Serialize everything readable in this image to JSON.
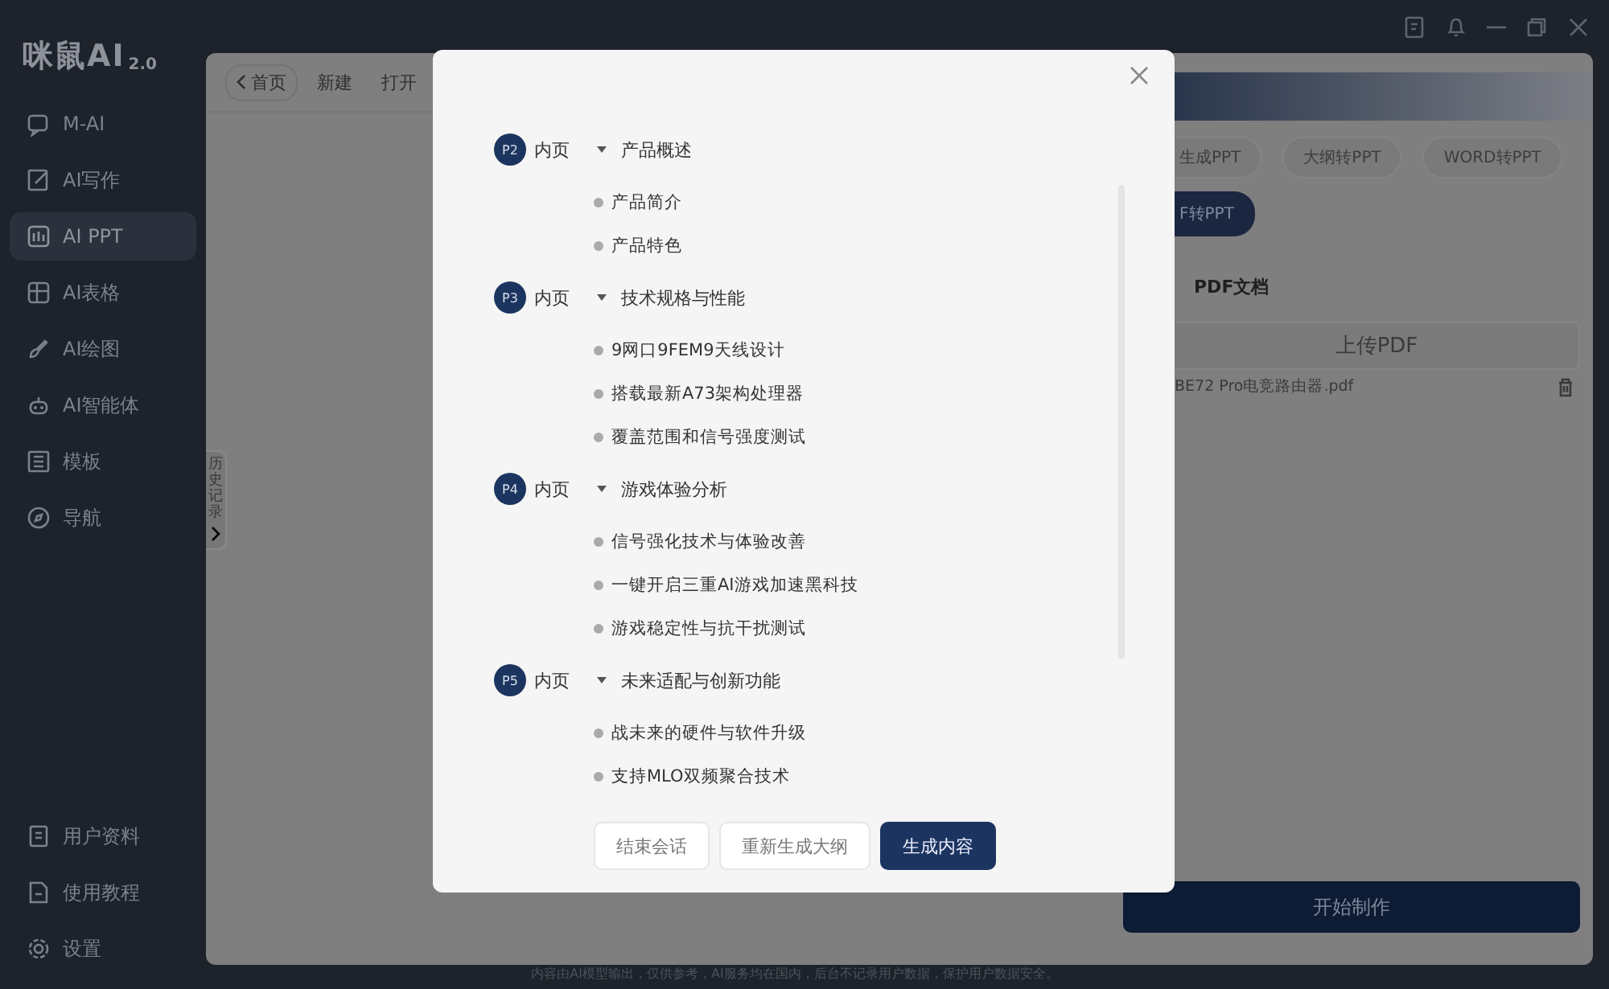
{
  "window": {
    "logo": "咪鼠AI",
    "logo_version": "2.0"
  },
  "sidebar": {
    "items": [
      {
        "label": "M-AI",
        "selected": false
      },
      {
        "label": "AI写作",
        "selected": false
      },
      {
        "label": "AI PPT",
        "selected": true
      },
      {
        "label": "AI表格",
        "selected": false
      },
      {
        "label": "AI绘图",
        "selected": false
      },
      {
        "label": "AI智能体",
        "selected": false
      },
      {
        "label": "模板",
        "selected": false
      },
      {
        "label": "导航",
        "selected": false
      }
    ],
    "bottom_items": [
      {
        "label": "用户资料",
        "selected": false
      },
      {
        "label": "使用教程",
        "selected": false
      },
      {
        "label": "设置",
        "selected": false
      }
    ]
  },
  "toolbar": {
    "items": [
      "首页",
      "新建",
      "打开"
    ]
  },
  "history_tab": "历史记录",
  "right_panel": {
    "modes": [
      {
        "label": "生成PPT",
        "selected": false
      },
      {
        "label": "大纲转PPT",
        "selected": false
      },
      {
        "label": "WORD转PPT",
        "selected": false
      },
      {
        "label": "F转PPT",
        "selected": true
      }
    ],
    "section_title": "PDF文档",
    "upload_button": "上传PDF",
    "file": "BE72 Pro电竞路由器.pdf",
    "start_button": "开始制作"
  },
  "dialog": {
    "outline": [
      {
        "page": "P2",
        "type": "内页",
        "title": "产品概述",
        "expanded": true,
        "children": [
          {
            "title": "产品简介"
          },
          {
            "title": "产品特色"
          }
        ]
      },
      {
        "page": "P3",
        "type": "内页",
        "title": "技术规格与性能",
        "expanded": true,
        "children": [
          {
            "title": "9网口9FEM9天线设计"
          },
          {
            "title": "搭载最新A73架构处理器"
          },
          {
            "title": "覆盖范围和信号强度测试"
          }
        ]
      },
      {
        "page": "P4",
        "type": "内页",
        "title": "游戏体验分析",
        "expanded": true,
        "children": [
          {
            "title": "信号强化技术与体验改善"
          },
          {
            "title": "一键开启三重AI游戏加速黑科技"
          },
          {
            "title": "游戏稳定性与抗干扰测试"
          }
        ]
      },
      {
        "page": "P5",
        "type": "内页",
        "title": "未来适配与创新功能",
        "expanded": true,
        "children": [
          {
            "title": "战未来的硬件与软件升级"
          },
          {
            "title": "支持MLO双频聚合技术"
          }
        ]
      }
    ],
    "buttons": [
      {
        "label": "结束会话",
        "kind": "secondary"
      },
      {
        "label": "重新生成大纲",
        "kind": "secondary"
      },
      {
        "label": "生成内容",
        "kind": "primary"
      }
    ]
  },
  "footer": "内容由AI模型输出，仅供参考，AI服务均在国内，后台不记录用户数据，保护用户数据安全。"
}
